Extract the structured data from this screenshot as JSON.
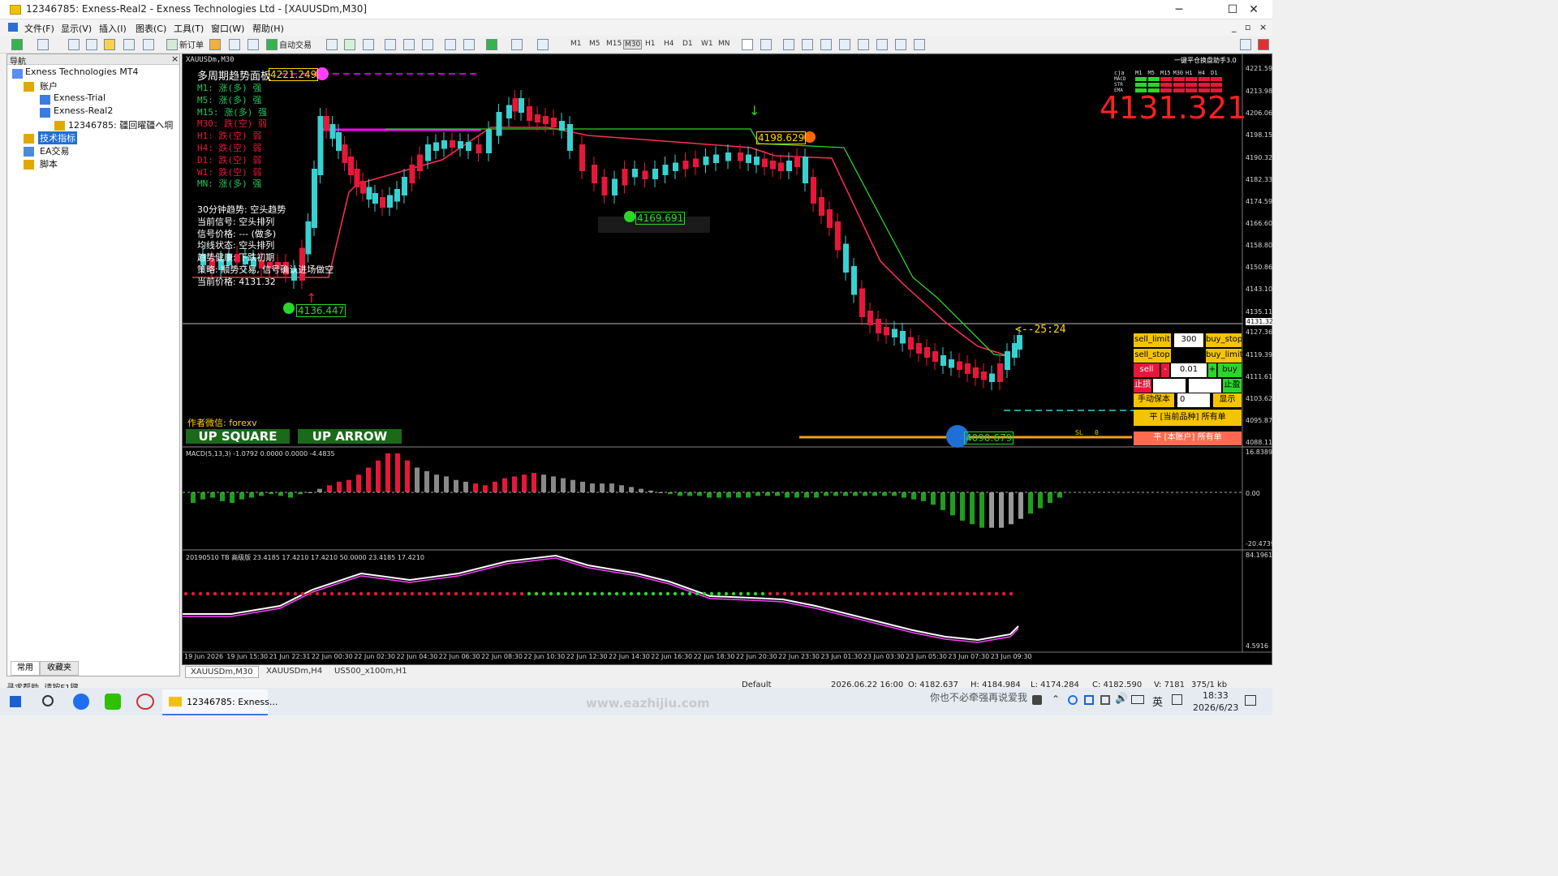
{
  "window": {
    "title": "12346785: Exness-Real2 - Exness Technologies Ltd - [XAUUSDm,M30]",
    "min": "─",
    "max": "☐",
    "close": "✕"
  },
  "menu": [
    "文件(F)",
    "显示(V)",
    "插入(I)",
    "图表(C)",
    "工具(T)",
    "窗口(W)",
    "帮助(H)"
  ],
  "toolbar": {
    "new_order": "新订单",
    "auto_trade": "自动交易",
    "timeframes": [
      "M1",
      "M5",
      "M15",
      "M30",
      "H1",
      "H4",
      "D1",
      "W1",
      "MN"
    ]
  },
  "navigator": {
    "title": "导航",
    "close": "×",
    "root": "Exness Technologies MT4",
    "accounts": "账户",
    "trial": "Exness-Trial",
    "real": "Exness-Real2",
    "account": "12346785: 疆回曜疆へ垌",
    "indicators": "技术指标",
    "ea": "EA交易",
    "scripts": "脚本",
    "tabs": [
      "常用",
      "收藏夹"
    ]
  },
  "chart": {
    "symbol": "XAUUSDm,M30",
    "watermark": "多周期趋势面板",
    "trends": [
      {
        "label": "M1: 涨(多) 强",
        "color": "#22c55e"
      },
      {
        "label": "M5: 涨(多) 强",
        "color": "#22c55e"
      },
      {
        "label": "M15: 涨(多) 强",
        "color": "#22c55e"
      },
      {
        "label": "M30: 跌(空) 弱",
        "color": "#e8173a"
      },
      {
        "label": "H1: 跌(空) 弱",
        "color": "#e8173a"
      },
      {
        "label": "H4: 跌(空) 弱",
        "color": "#e8173a"
      },
      {
        "label": "D1: 跌(空) 弱",
        "color": "#e8173a"
      },
      {
        "label": "W1: 跌(空) 弱",
        "color": "#e8173a"
      },
      {
        "label": "MN: 涨(多) 强",
        "color": "#22c55e"
      }
    ],
    "info": [
      "30分钟趋势: 空头趋势",
      "当前信号: 空头排列",
      "信号价格: --- (做多)",
      "均线状态: 空头排列",
      "趋势健康: 下跌初期",
      "策略: 顺势交易, 信号确认进场做空",
      "当前价格: 4131.32"
    ],
    "price_labels": {
      "p1": "4221.249",
      "p2": "4198.629",
      "p3": "4169.691",
      "p4": "4136.447",
      "p5": "4090.679"
    },
    "big_price": "4131.321",
    "countdown": "<--25:24",
    "author": "作者微信: forexv",
    "up_square": "UP SQUARE",
    "up_arrow": "UP ARROW",
    "assist_title": "一键平仓换盘助手3.0",
    "mini_tfs": [
      "cja",
      "M1",
      "M5",
      "M15",
      "M30",
      "H1",
      "H4",
      "D1"
    ],
    "mini_rows": [
      "MACD",
      "STR",
      "EMA"
    ],
    "sl_text": "SL",
    "sl_val": "0",
    "price_axis": [
      "4221.595",
      "4213.980",
      "4206.065",
      "4198.150",
      "4190.320",
      "4182.335",
      "4174.595",
      "4166.605",
      "4158.800",
      "4150.860",
      "4143.105",
      "4135.115",
      "4131.321",
      "4127.360",
      "4119.390",
      "4111.615",
      "4103.625",
      "4095.870",
      "4088.115"
    ],
    "macd_label": "MACD(5,13,3) -1.0792 0.0000 0.0000 -4.4835",
    "macd_axis": [
      "16.8389",
      "0.00",
      "-20.4739"
    ],
    "tb_label": "20190510 TB 高级版 23.4185 17.4210 17.4210 50.0000 23.4185 17.4210",
    "tb_axis": [
      "84.1961",
      "4.5916"
    ],
    "time_axis": [
      "19 Jun 2026",
      "19 Jun 15:30",
      "21 Jun 22:31",
      "22 Jun 00:30",
      "22 Jun 02:30",
      "22 Jun 04:30",
      "22 Jun 06:30",
      "22 Jun 08:30",
      "22 Jun 10:30",
      "22 Jun 12:30",
      "22 Jun 14:30",
      "22 Jun 16:30",
      "22 Jun 18:30",
      "22 Jun 20:30",
      "22 Jun 23:30",
      "23 Jun 01:30",
      "23 Jun 03:30",
      "23 Jun 05:30",
      "23 Jun 07:30",
      "23 Jun 09:30"
    ],
    "trade": {
      "sell_limit": "sell_limit",
      "buy_stop": "buy_stop",
      "sell_stop": "sell_stop",
      "buy_limit": "buy_limit",
      "points": "300",
      "sell": "sell",
      "minus": "-",
      "lots": "0.01",
      "plus": "+",
      "buy": "buy",
      "sl": "止损",
      "tp": "止盈",
      "manual_be": "手动保本",
      "be_val": "0",
      "show": "显示",
      "close_symbol": "平 [当前品种] 所有单",
      "close_account": "平 [本账户] 所有单"
    }
  },
  "chart_tabs": [
    "XAUUSDm,M30",
    "XAUUSDm,H4",
    "US500_x100m,H1"
  ],
  "status": {
    "help": "寻求帮助, 请按F1键",
    "profile": "Default",
    "time": "2026.06.22 16:00",
    "open": "O: 4182.637",
    "high": "H: 4184.984",
    "low": "L: 4174.284",
    "closep": "C: 4182.590",
    "vol": "V: 7181",
    "conn": "375/1 kb"
  },
  "taskbar": {
    "app": "12346785: Exness...",
    "watermark": "www.eazhijiu.com",
    "prompt": "你也不必牵强再说爱我",
    "lang": "英",
    "time": "18:33",
    "date": "2026/6/23"
  },
  "colors": {
    "bull": "#38d1d1",
    "bear": "#e8173a",
    "ma": "#ff2f55",
    "trail": "#2bd62b",
    "magenta": "#ff00ff",
    "gold": "#f5c400"
  }
}
